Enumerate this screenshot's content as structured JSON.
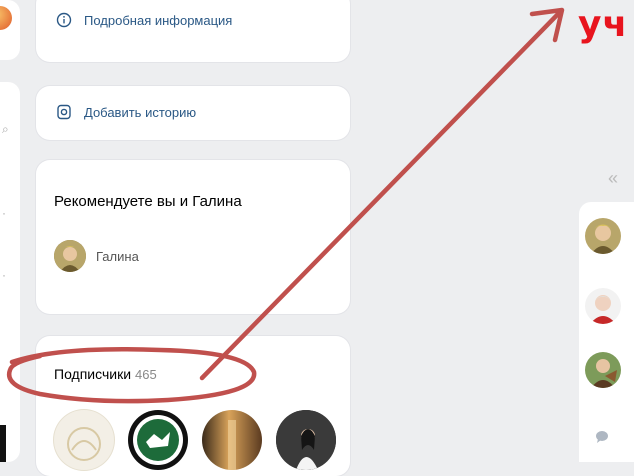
{
  "cards": {
    "info_label": "Подробная информация",
    "story_label": "Добавить историю",
    "recommend_title": "Рекомендуете вы и Галина",
    "recommend_person": "Галина",
    "subscribers_label": "Подписчики",
    "subscribers_count": "465"
  },
  "annotation": {
    "text": "уч",
    "color": "#e8141e",
    "arrow_color": "#c0504d"
  },
  "right_panel": {
    "collapse_icon": "«"
  },
  "icons": {
    "info": "info-circle-icon",
    "story": "story-camera-icon"
  }
}
